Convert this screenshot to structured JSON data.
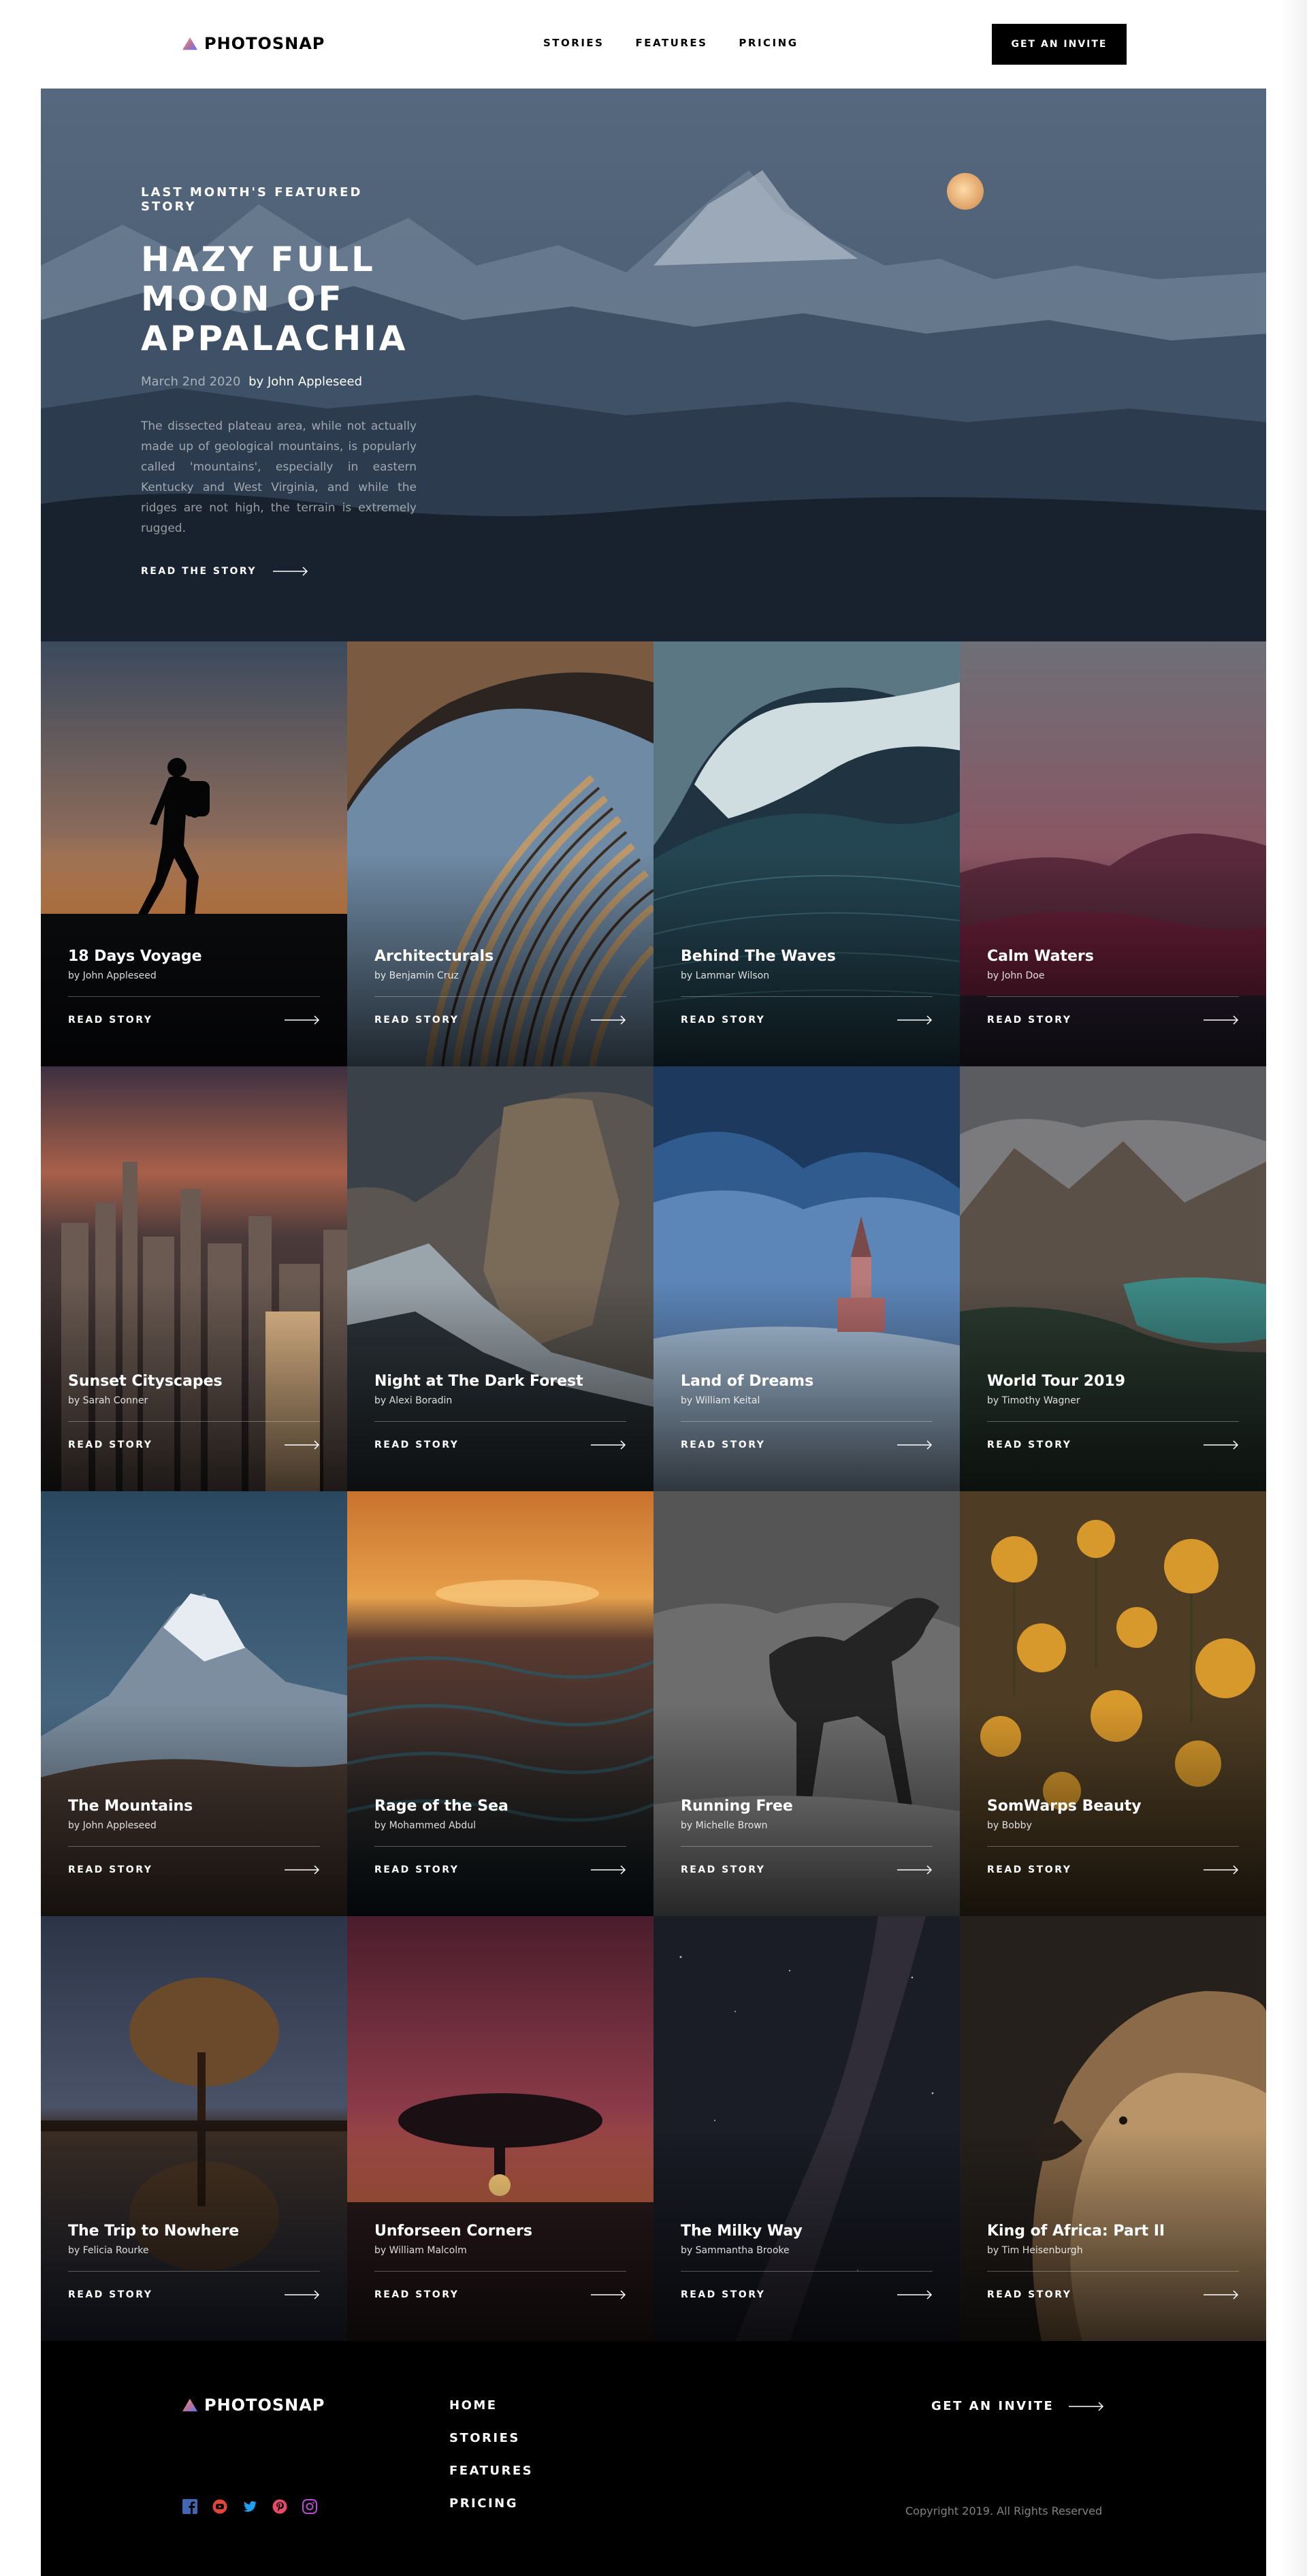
{
  "brand": {
    "name": "PHOTOSNAP"
  },
  "nav": {
    "items": [
      "STORIES",
      "FEATURES",
      "PRICING"
    ],
    "cta": "GET AN INVITE"
  },
  "hero": {
    "eyebrow": "LAST MONTH'S FEATURED STORY",
    "title_lines": [
      "HAZY FULL",
      "MOON OF",
      "APPALACHIA"
    ],
    "date": "March 2nd 2020",
    "author": "by John Appleseed",
    "description": "The dissected plateau area, while not actually made up of geological mountains, is popularly called 'mountains', especially in eastern Kentucky and West Virginia, and while the ridges are not high, the terrain is extremely rugged.",
    "cta": "READ THE STORY"
  },
  "stories": [
    {
      "title": "18 Days Voyage",
      "author": "by John Appleseed",
      "cta": "READ STORY",
      "scene": "hiker-sunset"
    },
    {
      "title": "Architecturals",
      "author": "by Benjamin Cruz",
      "cta": "READ STORY",
      "scene": "building"
    },
    {
      "title": "Behind The Waves",
      "author": "by Lammar Wilson",
      "cta": "READ STORY",
      "scene": "wave"
    },
    {
      "title": "Calm Waters",
      "author": "by John Doe",
      "cta": "READ STORY",
      "scene": "calm-lake"
    },
    {
      "title": "Sunset Cityscapes",
      "author": "by Sarah Conner",
      "cta": "READ STORY",
      "scene": "city"
    },
    {
      "title": "Night at The Dark Forest",
      "author": "by Alexi Boradin",
      "cta": "READ STORY",
      "scene": "granite-cliff"
    },
    {
      "title": "Land of Dreams",
      "author": "by William Keital",
      "cta": "READ STORY",
      "scene": "church"
    },
    {
      "title": "World Tour 2019",
      "author": "by Timothy Wagner",
      "cta": "READ STORY",
      "scene": "alpine-lake"
    },
    {
      "title": "The Mountains",
      "author": "by John Appleseed",
      "cta": "READ STORY",
      "scene": "peak"
    },
    {
      "title": "Rage of the Sea",
      "author": "by Mohammed Abdul",
      "cta": "READ STORY",
      "scene": "sea-sunset"
    },
    {
      "title": "Running Free",
      "author": "by Michelle Brown",
      "cta": "READ STORY",
      "scene": "horse"
    },
    {
      "title": "SomWarps Beauty",
      "author": "by Bobby",
      "cta": "READ STORY",
      "scene": "flowers"
    },
    {
      "title": "The Trip to Nowhere",
      "author": "by Felicia Rourke",
      "cta": "READ STORY",
      "scene": "tree-reflection"
    },
    {
      "title": "Unforseen Corners",
      "author": "by William Malcolm",
      "cta": "READ STORY",
      "scene": "tree-red-sky"
    },
    {
      "title": "The Milky Way",
      "author": "by Sammantha Brooke",
      "cta": "READ STORY",
      "scene": "milky-way"
    },
    {
      "title": "King of Africa: Part II",
      "author": "by Tim Heisenburgh",
      "cta": "READ STORY",
      "scene": "lion"
    }
  ],
  "footer": {
    "nav": [
      "HOME",
      "STORIES",
      "FEATURES",
      "PRICING"
    ],
    "cta": "GET AN INVITE",
    "copyright": "Copyright 2019. All Rights Reserved",
    "social": [
      {
        "name": "facebook-icon",
        "color": "#4267b2"
      },
      {
        "name": "youtube-icon",
        "color": "#e2453a"
      },
      {
        "name": "twitter-icon",
        "color": "#1da1f2"
      },
      {
        "name": "pinterest-icon",
        "color": "#e94a6b"
      },
      {
        "name": "instagram-icon",
        "color": "#b64fd1"
      }
    ]
  }
}
